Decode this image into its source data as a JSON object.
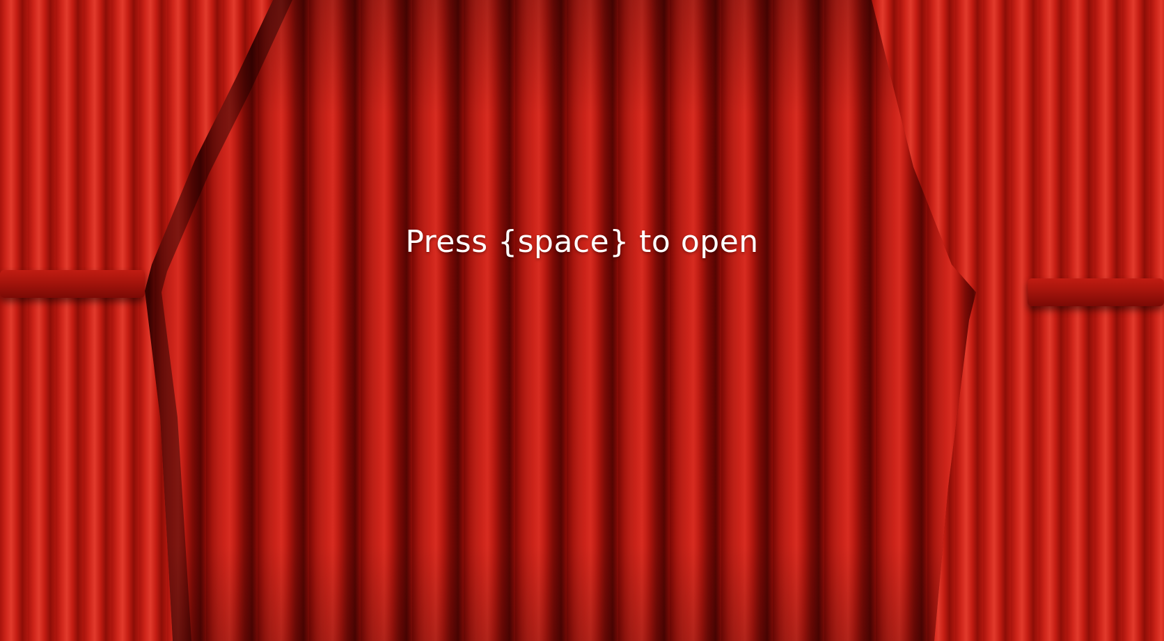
{
  "screen": {
    "prompt_text": "Press {space} to open"
  },
  "colors": {
    "curtain_red": "#c81f16",
    "curtain_dark": "#7a0804",
    "text": "#ffffff"
  }
}
